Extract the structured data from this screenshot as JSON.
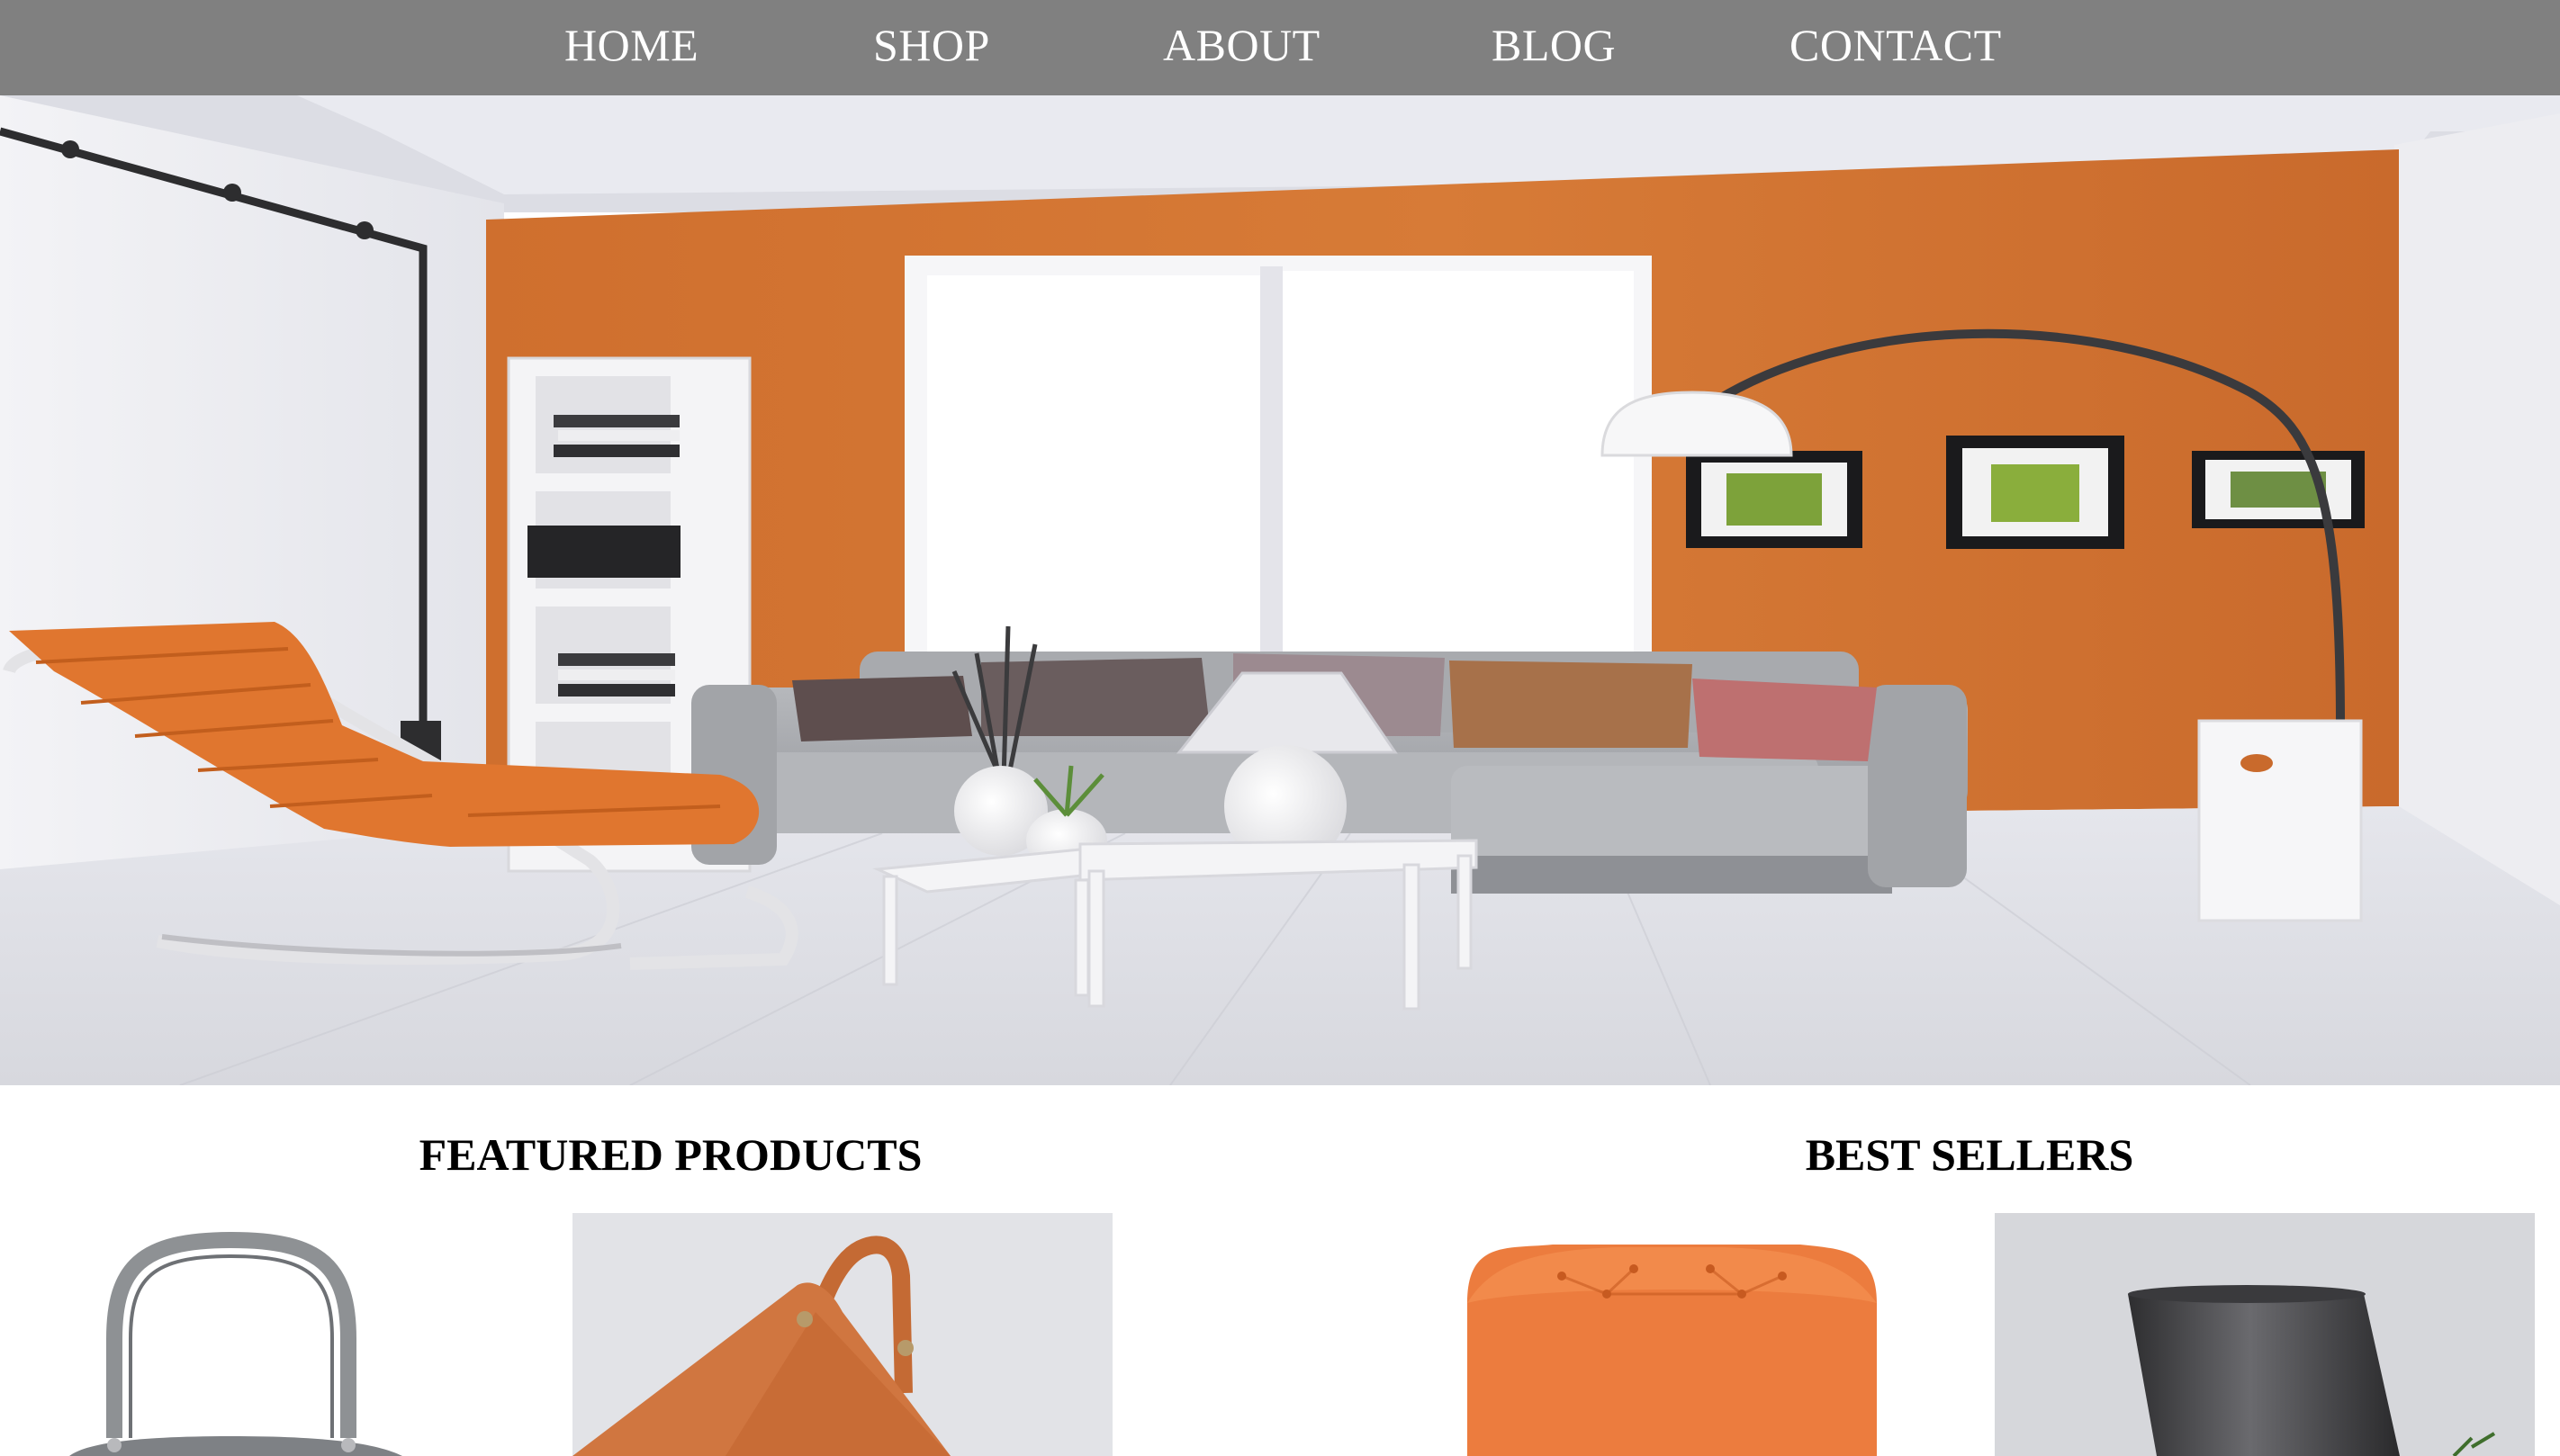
{
  "nav": {
    "items": [
      {
        "label": "HOME"
      },
      {
        "label": "SHOP"
      },
      {
        "label": "ABOUT"
      },
      {
        "label": "BLOG"
      },
      {
        "label": "CONTACT"
      }
    ]
  },
  "hero": {
    "image": "living-room-interior"
  },
  "featured": {
    "title": "FEATURED PRODUCTS",
    "products": [
      {
        "image": "grey-handbag"
      },
      {
        "image": "orange-tote-bag"
      }
    ]
  },
  "best_sellers": {
    "title": "BEST SELLERS",
    "products": [
      {
        "image": "orange-ottoman"
      },
      {
        "image": "dark-lamp"
      }
    ]
  },
  "colors": {
    "nav_bg": "#808080",
    "accent_orange": "#D27434",
    "sofa_grey": "#A9ABAF"
  }
}
